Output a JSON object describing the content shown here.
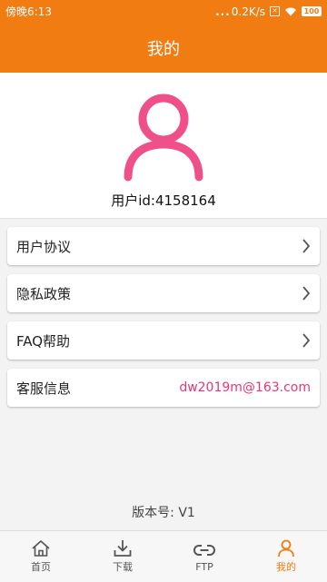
{
  "status_bar": {
    "time": "傍晚6:13",
    "net_speed": "0.2K/s",
    "battery": "100"
  },
  "header": {
    "title": "我的"
  },
  "profile": {
    "avatar_icon": "user-icon",
    "user_id": "用户id:4158164",
    "avatar_color": "#f0508a"
  },
  "menu": {
    "items": [
      {
        "label": "用户协议"
      },
      {
        "label": "隐私政策"
      },
      {
        "label": "FAQ帮助"
      },
      {
        "label": "客服信息",
        "value": "dw2019m@163.com"
      }
    ]
  },
  "version": "版本号: V1",
  "bottom_nav": {
    "items": [
      {
        "label": "首页",
        "icon": "home-icon"
      },
      {
        "label": "下载",
        "icon": "download-icon"
      },
      {
        "label": "FTP",
        "icon": "link-icon"
      },
      {
        "label": "我的",
        "icon": "user-icon",
        "active": true
      }
    ]
  },
  "colors": {
    "accent": "#f07c12",
    "pink": "#e8357a",
    "background": "#f3f3f3"
  }
}
